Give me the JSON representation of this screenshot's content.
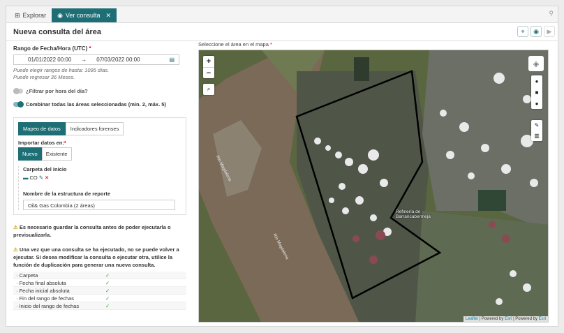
{
  "tabs": [
    {
      "icon": "grid-icon",
      "label": "Explorar"
    },
    {
      "icon": "eye-icon",
      "label": "Ver consulta"
    }
  ],
  "header": {
    "title": "Nueva consulta del área"
  },
  "daterange": {
    "label": "Rango de Fecha/Hora (UTC)",
    "start": "01/01/2022 00:00",
    "arrow": "→",
    "end": "07/03/2022 00:00",
    "hint1": "Puede elegir rangos de hasta: 1095 días.",
    "hint2": "Puede regresar 36 Meses."
  },
  "toggles": {
    "filter_hour": {
      "label": "¿Filtrar por hora del día?",
      "on": false
    },
    "combine": {
      "label": "Combinar todas las áreas seleccionadas (min. 2, máx. 5)",
      "on": true
    }
  },
  "panel": {
    "tabs": [
      "Mapeo de datos",
      "Indicadores forenses"
    ],
    "import_label": "Importar datos en:",
    "import_options": [
      "Nuevo",
      "Existente"
    ],
    "folder_label": "Carpeta del inicio",
    "folder_value": "CO",
    "report_label": "Nombre de la estructura de reporte",
    "report_value": "Oil& Gas Colombia (2 áreas)"
  },
  "warnings": [
    "Es necesario guardar la consulta antes de poder ejecutarla o previsualizarla.",
    "Una vez que una consulta se ha ejecutado, no se puede volver a ejecutar. Si desea modificar la consulta o ejecutar otra, utilice la función de duplicación para generar una nueva consulta."
  ],
  "checklist": [
    {
      "name": "Carpeta",
      "ok": "✓"
    },
    {
      "name": "Fecha final absoluta",
      "ok": "✓"
    },
    {
      "name": "Fecha inicial absoluta",
      "ok": "✓"
    },
    {
      "name": "Fin del rango de fechas",
      "ok": "✓"
    },
    {
      "name": "Inicio del rango de fechas",
      "ok": "✓"
    }
  ],
  "map": {
    "label": "Seleccione el área en el mapa",
    "place_line1": "Refinería de",
    "place_line2": "Barrancabermeja",
    "river1": "Río Magdalena",
    "river2": "Río Magdalena",
    "attribution": {
      "leaflet": "Leaflet",
      "sep1": " | Powered by ",
      "esri1": "Esri",
      "sep2": " | Powered by ",
      "esri2": "Esri"
    }
  },
  "colors": {
    "accent": "#1e6f75",
    "required": "#d0021b",
    "warning": "#e0a800",
    "check": "#2e9d3e"
  }
}
